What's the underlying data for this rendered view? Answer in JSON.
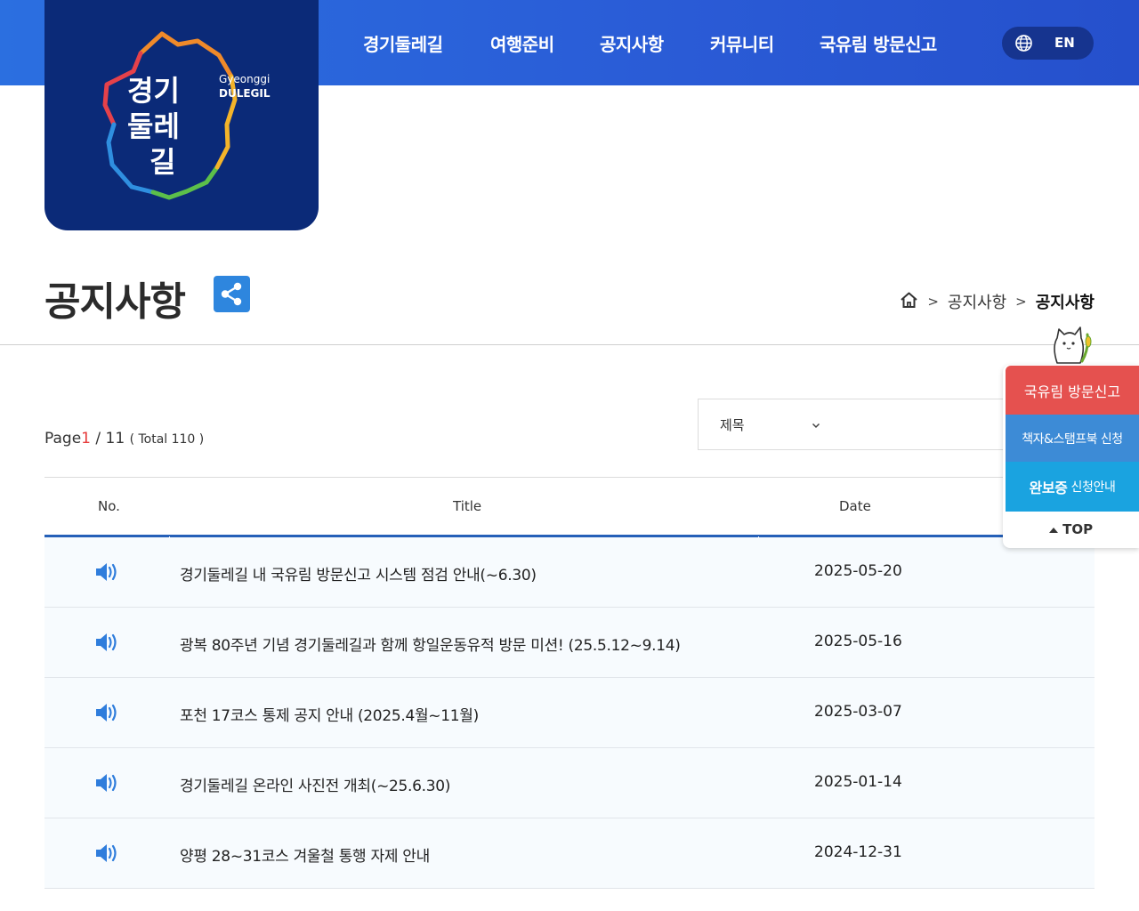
{
  "header": {
    "logo": {
      "title_ko": "경기둘레길",
      "title_en_line1": "Gyeonggi",
      "title_en_line2": "DULEGIL"
    },
    "nav": [
      "경기둘레길",
      "여행준비",
      "공지사항",
      "커뮤니티",
      "국유림 방문신고"
    ],
    "lang": {
      "icon": "globe-icon",
      "label": "EN"
    },
    "colors": {
      "bar": "#2a5bd6",
      "logo_bg": "#0b2a78"
    }
  },
  "page": {
    "title": "공지사항",
    "share_icon": "share-icon",
    "breadcrumb": {
      "home_icon": "home-icon",
      "sep": ">",
      "items": [
        "공지사항",
        "공지사항"
      ]
    }
  },
  "listing": {
    "page_label": "Page",
    "current_page": "1",
    "page_sep": "/ 11",
    "total": "( Total 110 )",
    "search_field": "제목"
  },
  "table": {
    "headers": {
      "no": "No.",
      "title": "Title",
      "date": "Date"
    },
    "rows": [
      {
        "icon": "speaker-icon",
        "title": "경기둘레길 내 국유림 방문신고 시스템 점검 안내(~6.30)",
        "date": "2025-05-20"
      },
      {
        "icon": "speaker-icon",
        "title": "광복 80주년 기념 경기둘레길과 함께 항일운동유적 방문 미션! (25.5.12~9.14)",
        "date": "2025-05-16"
      },
      {
        "icon": "speaker-icon",
        "title": "포천 17코스 통제 공지 안내 (2025.4월~11월)",
        "date": "2025-03-07"
      },
      {
        "icon": "speaker-icon",
        "title": "경기둘레길 온라인 사진전 개최(~25.6.30)",
        "date": "2025-01-14"
      },
      {
        "icon": "speaker-icon",
        "title": "양평 28~31코스 겨울철 통행 자제 안내",
        "date": "2024-12-31"
      }
    ]
  },
  "quick_menu": {
    "visit_report": "국유림 방문신고",
    "stampbook": "책자&스탬프북 신청",
    "complete_bold": "완보증",
    "complete_rest": "신청안내",
    "top": "TOP",
    "colors": {
      "visit": "#e5514f",
      "stamp": "#3d8bd6",
      "complete": "#1aa3e0"
    }
  }
}
